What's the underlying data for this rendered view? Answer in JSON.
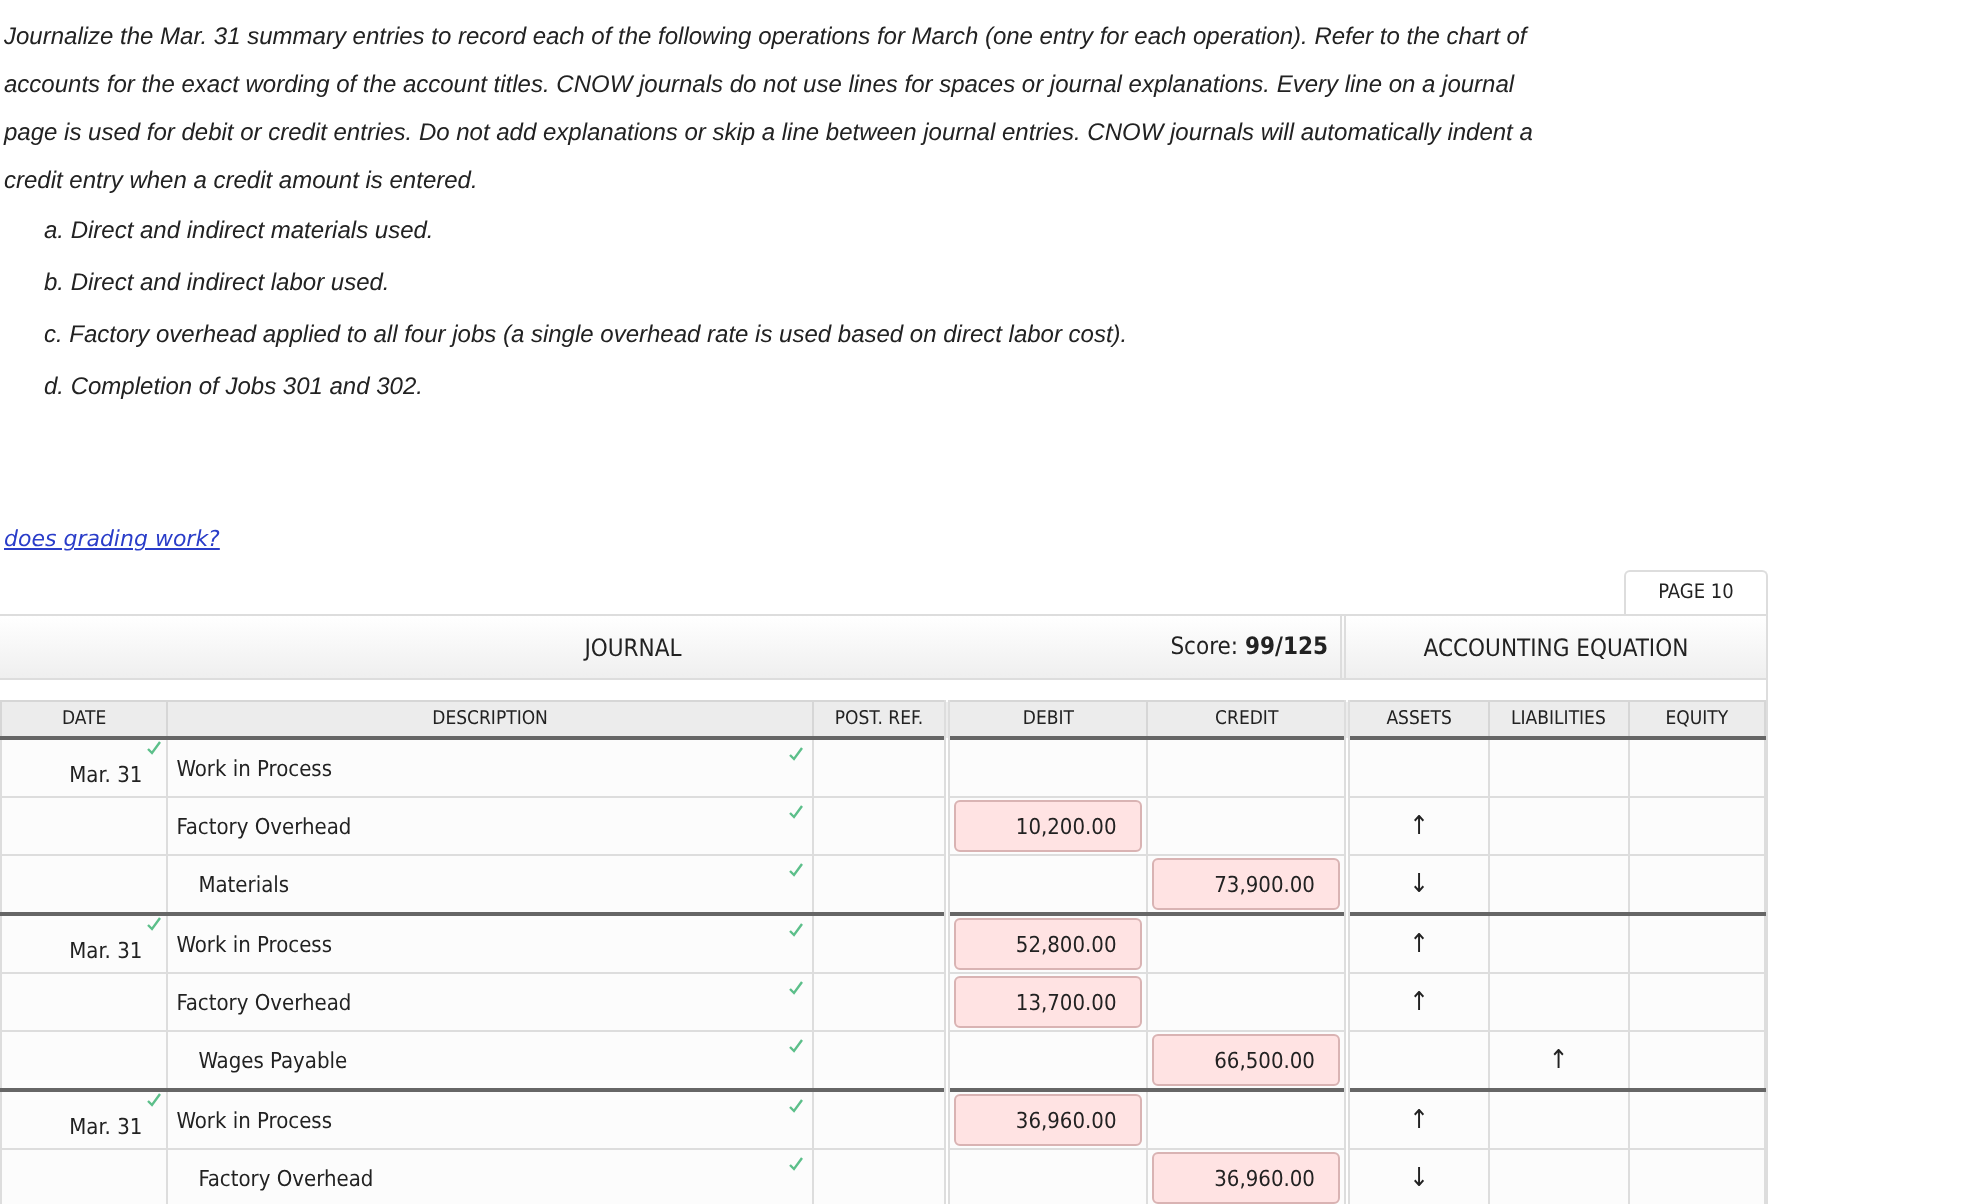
{
  "instructions": "Journalize the Mar. 31 summary entries to record each of the following operations for March (one entry for each operation). Refer to the chart of accounts for the exact wording of the account titles. CNOW journals do not use lines for spaces or journal explanations. Every line on a journal page is used for debit or credit entries. Do not add explanations or skip a line between journal entries. CNOW journals will automatically indent a credit entry when a credit amount is entered.",
  "operations": [
    "a. Direct and indirect materials used.",
    "b. Direct and indirect labor used.",
    "c. Factory overhead applied to all four jobs (a single overhead rate is used based on direct labor cost).",
    "d. Completion of Jobs 301 and 302."
  ],
  "help_link": "does grading work?",
  "journal": {
    "page_tab": "PAGE 10",
    "title": "JOURNAL",
    "score": "Score: **99/125**",
    "equation_title": "ACCOUNTING EQUATION",
    "columns": [
      "DATE",
      "DESCRIPTION",
      "POST. REF.",
      "DEBIT",
      "CREDIT",
      "ASSETS",
      "LIABILITIES",
      "EQUITY"
    ],
    "entries": [
      {
        "date": "Mar. 31",
        "date_checked": true,
        "lines": [
          {
            "account": "Work in Process",
            "indented": false,
            "checked": true
          },
          {
            "account": "Factory Overhead",
            "indented": false,
            "checked": true,
            "debit": {
              "value": "10,200.00",
              "incorrect": true
            },
            "assets": "↑"
          },
          {
            "account": "Materials",
            "indented": true,
            "checked": true,
            "credit": {
              "value": "73,900.00",
              "incorrect": true
            },
            "assets": "↓"
          }
        ]
      },
      {
        "date": "Mar. 31",
        "date_checked": true,
        "lines": [
          {
            "account": "Work in Process",
            "indented": false,
            "checked": true,
            "debit": {
              "value": "52,800.00",
              "incorrect": true
            },
            "assets": "↑"
          },
          {
            "account": "Factory Overhead",
            "indented": false,
            "checked": true,
            "debit": {
              "value": "13,700.00",
              "incorrect": true
            },
            "assets": "↑"
          },
          {
            "account": "Wages Payable",
            "indented": true,
            "checked": true,
            "credit": {
              "value": "66,500.00",
              "incorrect": true
            },
            "liabilities": "↑"
          }
        ]
      },
      {
        "date": "Mar. 31",
        "date_checked": true,
        "lines": [
          {
            "account": "Work in Process",
            "indented": false,
            "checked": true,
            "debit": {
              "value": "36,960.00",
              "incorrect": true
            },
            "assets": "↑"
          },
          {
            "account": "Factory Overhead",
            "indented": true,
            "checked": true,
            "credit": {
              "value": "36,960.00",
              "incorrect": true
            },
            "assets": "↓"
          }
        ]
      }
    ]
  }
}
